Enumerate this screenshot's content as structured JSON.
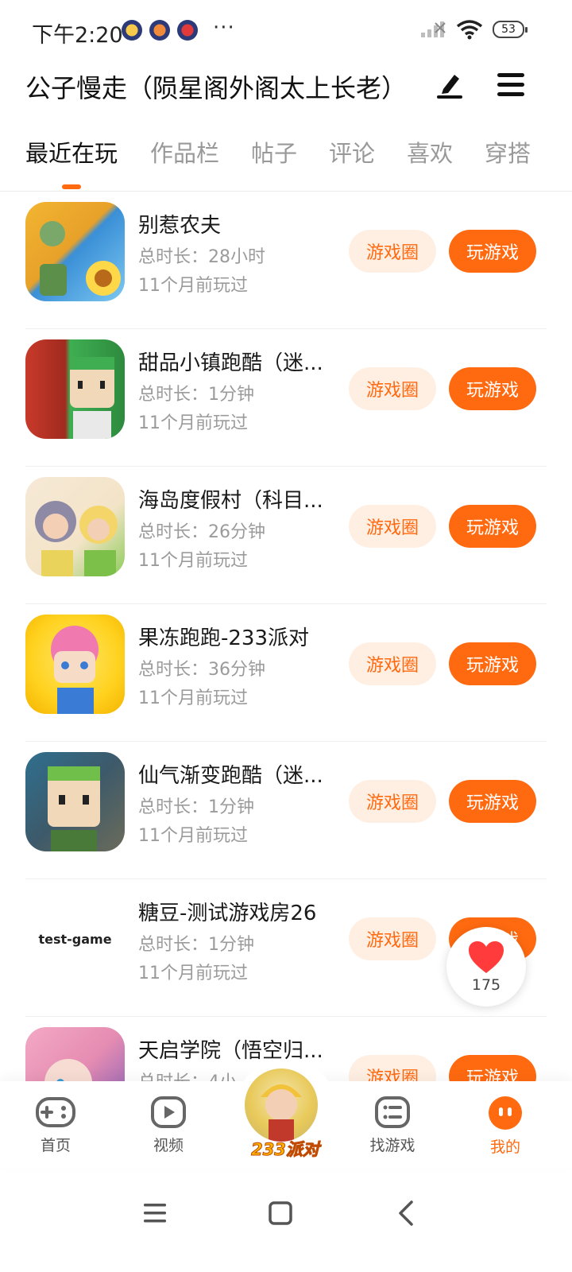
{
  "status_bar": {
    "time": "下午2:20",
    "more": "···",
    "battery": "53"
  },
  "header": {
    "title": "公子慢走（陨星阁外阁太上长老）"
  },
  "tabs": [
    {
      "label": "最近在玩",
      "active": true
    },
    {
      "label": "作品栏",
      "active": false
    },
    {
      "label": "帖子",
      "active": false
    },
    {
      "label": "评论",
      "active": false
    },
    {
      "label": "喜欢",
      "active": false
    },
    {
      "label": "穿搭",
      "active": false
    }
  ],
  "games": [
    {
      "name": "别惹农夫",
      "duration": "总时长：28小时",
      "last_played": "11个月前玩过",
      "circle_label": "游戏圈",
      "play_label": "玩游戏",
      "thumb_colors": [
        "#f2b531",
        "#3a8fd6"
      ]
    },
    {
      "name": "甜品小镇跑酷（迷...",
      "duration": "总时长：1分钟",
      "last_played": "11个月前玩过",
      "circle_label": "游戏圈",
      "play_label": "玩游戏",
      "thumb_colors": [
        "#c83a2a",
        "#3fae52"
      ]
    },
    {
      "name": "海岛度假村（科目...",
      "duration": "总时长：26分钟",
      "last_played": "11个月前玩过",
      "circle_label": "游戏圈",
      "play_label": "玩游戏",
      "thumb_colors": [
        "#f6e9d6",
        "#8fcc5a"
      ]
    },
    {
      "name": "果冻跑跑-233派对",
      "duration": "总时长：36分钟",
      "last_played": "11个月前玩过",
      "circle_label": "游戏圈",
      "play_label": "玩游戏",
      "thumb_colors": [
        "#ffd21f",
        "#f07ab0"
      ]
    },
    {
      "name": "仙气渐变跑酷（迷...",
      "duration": "总时长：1分钟",
      "last_played": "11个月前玩过",
      "circle_label": "游戏圈",
      "play_label": "玩游戏",
      "thumb_colors": [
        "#2f6f8f",
        "#6fbf4a"
      ]
    },
    {
      "name": "糖豆-测试游戏房26",
      "duration": "总时长：1分钟",
      "last_played": "11个月前玩过",
      "circle_label": "游戏圈",
      "play_label": "玩游戏",
      "thumb_text": "test-game"
    },
    {
      "name": "天启学院（悟空归...",
      "duration": "总时长：4小",
      "last_played": "",
      "circle_label": "游戏圈",
      "play_label": "玩游戏",
      "thumb_colors": [
        "#f3a9c4",
        "#7a5ab8"
      ]
    }
  ],
  "like_badge": {
    "count": "175",
    "color": "#ff3b3b"
  },
  "bottom_nav": {
    "items": [
      {
        "label": "首页",
        "icon": "gamepad-icon"
      },
      {
        "label": "视频",
        "icon": "play-icon"
      },
      {
        "label": "233派对",
        "icon": "party-avatar"
      },
      {
        "label": "找游戏",
        "icon": "list-icon"
      },
      {
        "label": "我的",
        "icon": "face-icon",
        "active": true
      }
    ]
  },
  "theme": {
    "accent": "#ff6a10",
    "accent_light": "#ffefe3"
  }
}
